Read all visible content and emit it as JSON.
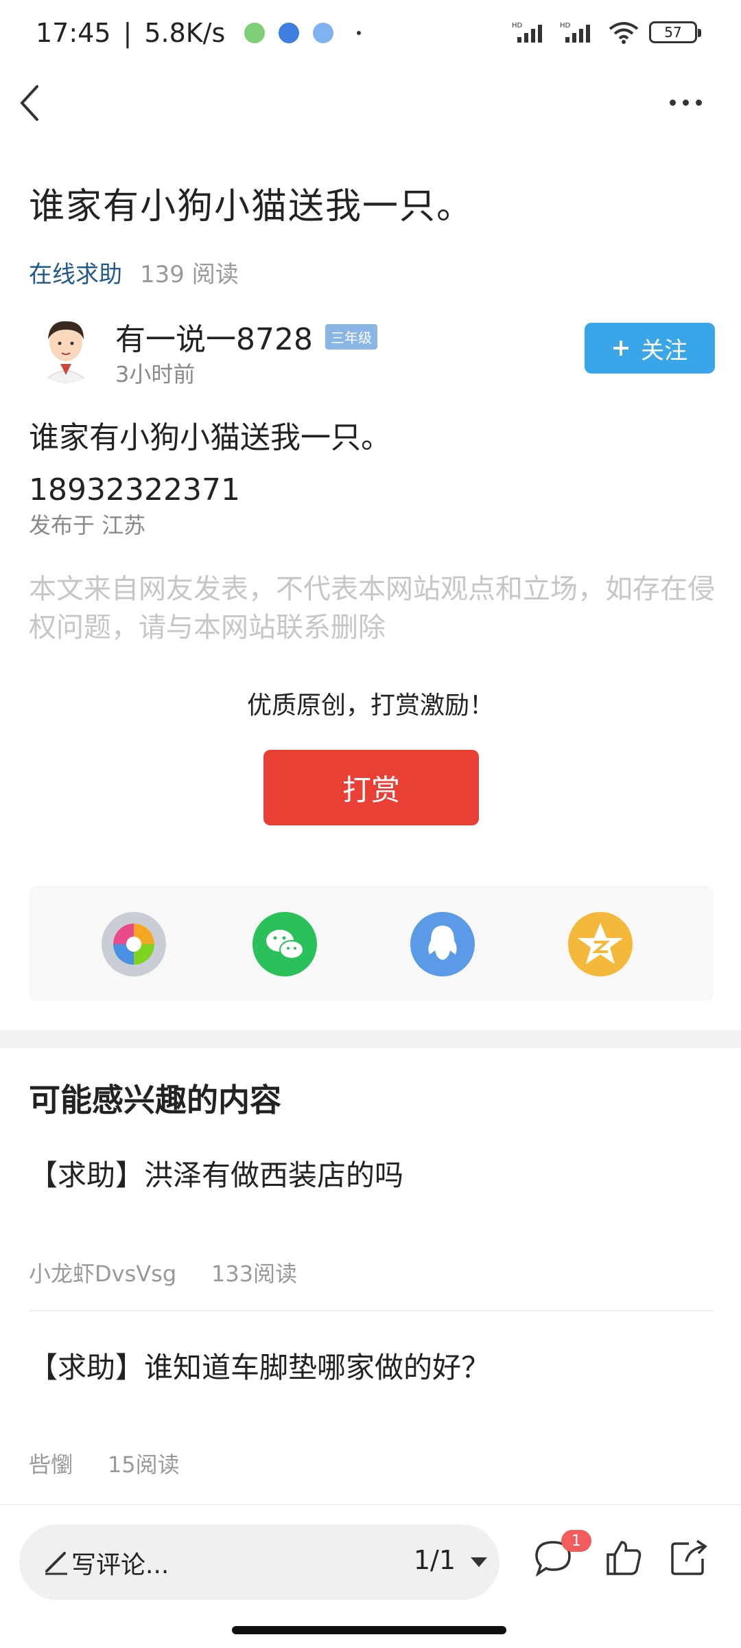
{
  "status_bar": {
    "time": "17:45",
    "separator": "|",
    "net_speed": "5.8K/s",
    "battery": "57"
  },
  "article": {
    "title": "谁家有小狗小猫送我一只。",
    "category": "在线求助",
    "reads": "139 阅读",
    "author": {
      "name": "有一说一8728",
      "level": "三年级",
      "time": "3小时前"
    },
    "follow_label": "关注",
    "body_line1": "谁家有小狗小猫送我一只。",
    "body_line2": "18932322371",
    "location": "发布于 江苏",
    "disclaimer": "本文来自网友发表，不代表本网站观点和立场，如存在侵权问题，请与本网站联系删除"
  },
  "reward": {
    "text": "优质原创，打赏激励！",
    "button": "打赏"
  },
  "share": {
    "icons": [
      "moments-icon",
      "wechat-icon",
      "qq-icon",
      "qzone-icon"
    ],
    "colors": [
      "#c9ced6",
      "#2bc15a",
      "#5b9ae6",
      "#f4b93a"
    ]
  },
  "recommend": {
    "title": "可能感兴趣的内容",
    "items": [
      {
        "title": "【求助】洪泽有做西装店的吗",
        "author": "小龙虾DvsVsg",
        "reads": "133阅读"
      },
      {
        "title": "【求助】谁知道车脚垫哪家做的好？",
        "author": "呰懰",
        "reads": "15阅读"
      }
    ]
  },
  "bottom_bar": {
    "comment_placeholder": "写评论...",
    "page": "1/1",
    "comment_count": "1"
  }
}
